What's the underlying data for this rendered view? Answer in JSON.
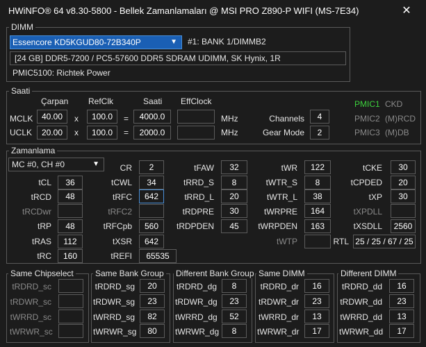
{
  "window": {
    "title": "HWiNFO® 64 v8.30-5800 - Bellek Zamanlamaları @ MSI PRO Z890-P WIFI (MS-7E34)",
    "close_glyph": "✕"
  },
  "dimm": {
    "group_label": "DIMM",
    "module_select": "Essencore KD5KGUD80-72B340P",
    "bank_text": "#1: BANK 1/DIMMB2",
    "description": "[24 GB] DDR5-7200 / PC5-57600 DDR5 SDRAM UDIMM, SK Hynix, 1R",
    "pmic": "PMIC5100: Richtek Power"
  },
  "clock": {
    "group_label": "Saati",
    "col_carpan": "Çarpan",
    "col_refclk": "RefClk",
    "col_saati": "Saati",
    "col_effclock": "EffClock",
    "mclk": {
      "label": "MCLK",
      "mult": "40.00",
      "x": "x",
      "ref": "100.0",
      "eq": "=",
      "freq": "4000.0",
      "eff": "",
      "unit": "MHz"
    },
    "uclk": {
      "label": "UCLK",
      "mult": "20.00",
      "x": "x",
      "ref": "100.0",
      "eq": "=",
      "freq": "2000.0",
      "eff": "",
      "unit": "MHz"
    },
    "channels_label": "Channels",
    "channels_value": "4",
    "gearmode_label": "Gear Mode",
    "gearmode_value": "2",
    "pmic_status": [
      {
        "name": "PMIC1",
        "state": "CKD"
      },
      {
        "name": "PMIC2",
        "state": "(M)RCD"
      },
      {
        "name": "PMIC3",
        "state": "(M)DB"
      }
    ],
    "colors": {
      "pmic_active": "#3cd13c",
      "pmic_inactive": "#8a8a8a"
    }
  },
  "timing": {
    "group_label": "Zamanlama",
    "channel_select": "MC #0, CH #0",
    "tCL": {
      "label": "tCL",
      "value": "36"
    },
    "tRCD": {
      "label": "tRCD",
      "value": "48"
    },
    "tRCDwr": {
      "label": "tRCDwr",
      "value": ""
    },
    "tRP": {
      "label": "tRP",
      "value": "48"
    },
    "tRAS": {
      "label": "tRAS",
      "value": "112"
    },
    "tRC": {
      "label": "tRC",
      "value": "160"
    },
    "CR": {
      "label": "CR",
      "value": "2"
    },
    "tCWL": {
      "label": "tCWL",
      "value": "34"
    },
    "tRFC": {
      "label": "tRFC",
      "value": "642"
    },
    "tRFC2": {
      "label": "tRFC2",
      "value": ""
    },
    "tRFCpb": {
      "label": "tRFCpb",
      "value": "560"
    },
    "tXSR": {
      "label": "tXSR",
      "value": "642"
    },
    "tREFI": {
      "label": "tREFI",
      "value": "65535"
    },
    "tFAW": {
      "label": "tFAW",
      "value": "32"
    },
    "tRRD_S": {
      "label": "tRRD_S",
      "value": "8"
    },
    "tRRD_L": {
      "label": "tRRD_L",
      "value": "20"
    },
    "tRDPRE": {
      "label": "tRDPRE",
      "value": "30"
    },
    "tRDPDEN": {
      "label": "tRDPDEN",
      "value": "45"
    },
    "tWR": {
      "label": "tWR",
      "value": "122"
    },
    "tWTR_S": {
      "label": "tWTR_S",
      "value": "8"
    },
    "tWTR_L": {
      "label": "tWTR_L",
      "value": "38"
    },
    "tWRPRE": {
      "label": "tWRPRE",
      "value": "164"
    },
    "tWRPDEN": {
      "label": "tWRPDEN",
      "value": "163"
    },
    "tWTP": {
      "label": "tWTP",
      "value": ""
    },
    "tCKE": {
      "label": "tCKE",
      "value": "30"
    },
    "tCPDED": {
      "label": "tCPDED",
      "value": "20"
    },
    "tXP": {
      "label": "tXP",
      "value": "30"
    },
    "tXPDLL": {
      "label": "tXPDLL",
      "value": ""
    },
    "tXSDLL": {
      "label": "tXSDLL",
      "value": "2560"
    },
    "RTL": {
      "label": "RTL",
      "value": "25 / 25 / 67 / 25"
    }
  },
  "same_chipselect": {
    "label": "Same Chipselect",
    "rows": [
      {
        "label": "tRDRD_sc",
        "value": ""
      },
      {
        "label": "tRDWR_sc",
        "value": ""
      },
      {
        "label": "tWRRD_sc",
        "value": ""
      },
      {
        "label": "tWRWR_sc",
        "value": ""
      }
    ]
  },
  "same_bank_group": {
    "label": "Same Bank Group",
    "rows": [
      {
        "label": "tRDRD_sg",
        "value": "20"
      },
      {
        "label": "tRDWR_sg",
        "value": "23"
      },
      {
        "label": "tWRRD_sg",
        "value": "82"
      },
      {
        "label": "tWRWR_sg",
        "value": "80"
      }
    ]
  },
  "diff_bank_group": {
    "label": "Different Bank Group",
    "rows": [
      {
        "label": "tRDRD_dg",
        "value": "8"
      },
      {
        "label": "tRDWR_dg",
        "value": "23"
      },
      {
        "label": "tWRRD_dg",
        "value": "52"
      },
      {
        "label": "tWRWR_dg",
        "value": "8"
      }
    ]
  },
  "same_dimm": {
    "label": "Same DIMM",
    "rows": [
      {
        "label": "tRDRD_dr",
        "value": "16"
      },
      {
        "label": "tRDWR_dr",
        "value": "23"
      },
      {
        "label": "tWRRD_dr",
        "value": "13"
      },
      {
        "label": "tWRWR_dr",
        "value": "17"
      }
    ]
  },
  "diff_dimm": {
    "label": "Different DIMM",
    "rows": [
      {
        "label": "tRDRD_dd",
        "value": "16"
      },
      {
        "label": "tRDWR_dd",
        "value": "23"
      },
      {
        "label": "tWRRD_dd",
        "value": "13"
      },
      {
        "label": "tWRWR_dd",
        "value": "17"
      }
    ]
  }
}
